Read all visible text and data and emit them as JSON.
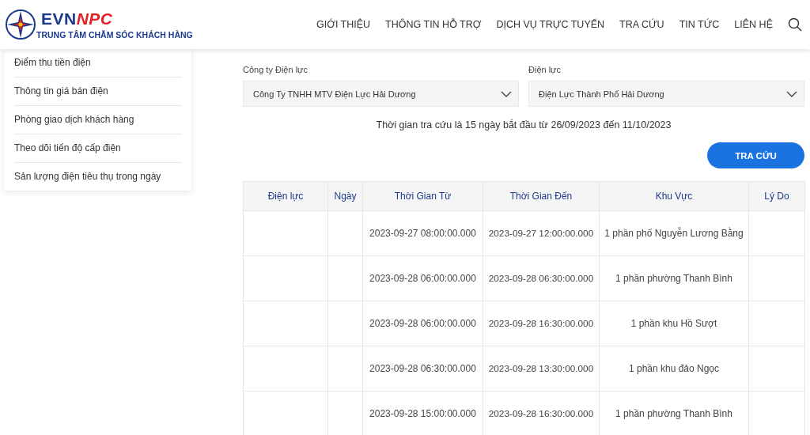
{
  "header": {
    "brand_primary": "EVN",
    "brand_secondary": "NPC",
    "subtitle": "TRUNG TÂM CHĂM SÓC KHÁCH HÀNG",
    "nav": [
      {
        "label": "GIỚI THIỆU"
      },
      {
        "label": "THÔNG TIN HỖ TRỢ"
      },
      {
        "label": "DỊCH VỤ TRỰC TUYẾN"
      },
      {
        "label": "TRA CỨU"
      },
      {
        "label": "TIN TỨC"
      },
      {
        "label": "LIÊN HỆ"
      }
    ]
  },
  "sidebar": {
    "items": [
      {
        "label": "Điểm thu tiền điện"
      },
      {
        "label": "Thông tin giá bán điện"
      },
      {
        "label": "Phòng giao dịch khách hàng"
      },
      {
        "label": "Theo dõi tiến độ cấp điện"
      },
      {
        "label": "Sản lượng điện tiêu thụ trong ngày"
      }
    ]
  },
  "form": {
    "fields": [
      {
        "label": "Công ty Điện lực",
        "value": "Công Ty TNHH MTV Điện Lực Hải Dương"
      },
      {
        "label": "Điện lực",
        "value": "Điện Lực Thành Phố Hải Dương"
      }
    ],
    "note": "Thời gian tra cứu là 15 ngày bắt đầu từ 26/09/2023 đến 11/10/2023",
    "button": "TRA CỨU"
  },
  "table": {
    "columns": [
      "Điện lực",
      "Ngày",
      "Thời Gian Từ",
      "Thời Gian Đến",
      "Khu Vực",
      "Lý Do"
    ],
    "rows": [
      [
        "",
        "",
        "2023-09-27 08:00:00.000",
        "2023-09-27 12:00:00.000",
        "1 phần phố Nguyễn Lương Bằng",
        ""
      ],
      [
        "",
        "",
        "2023-09-28 06:00:00.000",
        "2023-09-28 06:30:00.000",
        "1 phần phường Thanh Bình",
        ""
      ],
      [
        "",
        "",
        "2023-09-28 06:00:00.000",
        "2023-09-28 16:30:00.000",
        "1 phần khu Hồ Sượt",
        ""
      ],
      [
        "",
        "",
        "2023-09-28 06:30:00.000",
        "2023-09-28 13:30:00.000",
        "1 phần khu đảo Ngọc",
        ""
      ],
      [
        "",
        "",
        "2023-09-28 15:00:00.000",
        "2023-09-28 16:30:00.000",
        "1 phần phường Thanh Bình",
        ""
      ]
    ]
  }
}
